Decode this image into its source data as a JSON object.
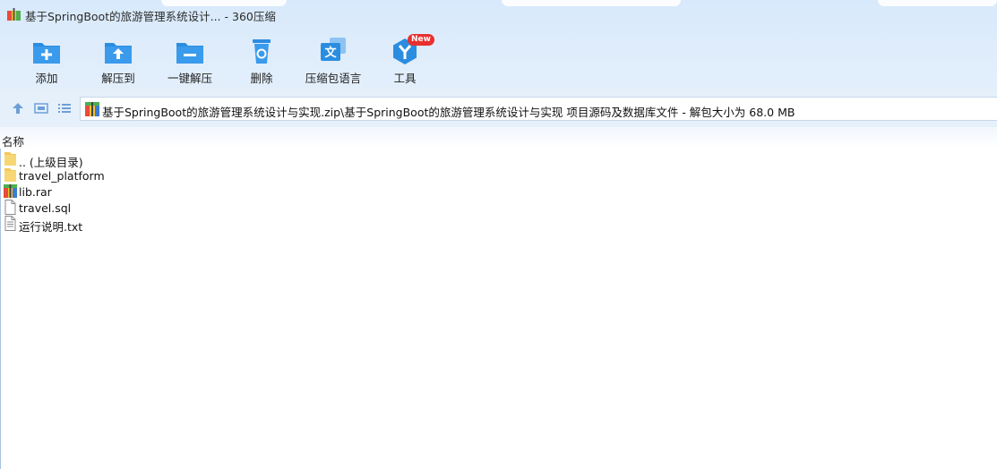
{
  "window": {
    "title": "基于SpringBoot的旅游管理系统设计... - 360压缩"
  },
  "toolbar": {
    "items": [
      {
        "label": "添加",
        "icon": "folder-add-icon"
      },
      {
        "label": "解压到",
        "icon": "folder-extract-icon"
      },
      {
        "label": "一键解压",
        "icon": "folder-minus-icon"
      },
      {
        "label": "删除",
        "icon": "recycle-bin-icon"
      },
      {
        "label": "压缩包语言",
        "icon": "language-icon"
      },
      {
        "label": "工具",
        "icon": "tools-icon",
        "badge": "New"
      }
    ]
  },
  "address": {
    "path": "基于SpringBoot的旅游管理系统设计与实现.zip\\基于SpringBoot的旅游管理系统设计与实现 项目源码及数据库文件 - 解包大小为 68.0 MB"
  },
  "columns": {
    "name": "名称"
  },
  "files": [
    {
      "name": ".. (上级目录)",
      "type": "folder"
    },
    {
      "name": "travel_platform",
      "type": "folder"
    },
    {
      "name": "lib.rar",
      "type": "archive"
    },
    {
      "name": "travel.sql",
      "type": "file"
    },
    {
      "name": "运行说明.txt",
      "type": "text"
    }
  ],
  "colors": {
    "accent": "#2b8de0",
    "folder": "#f7d774",
    "badge": "#e8302f"
  }
}
